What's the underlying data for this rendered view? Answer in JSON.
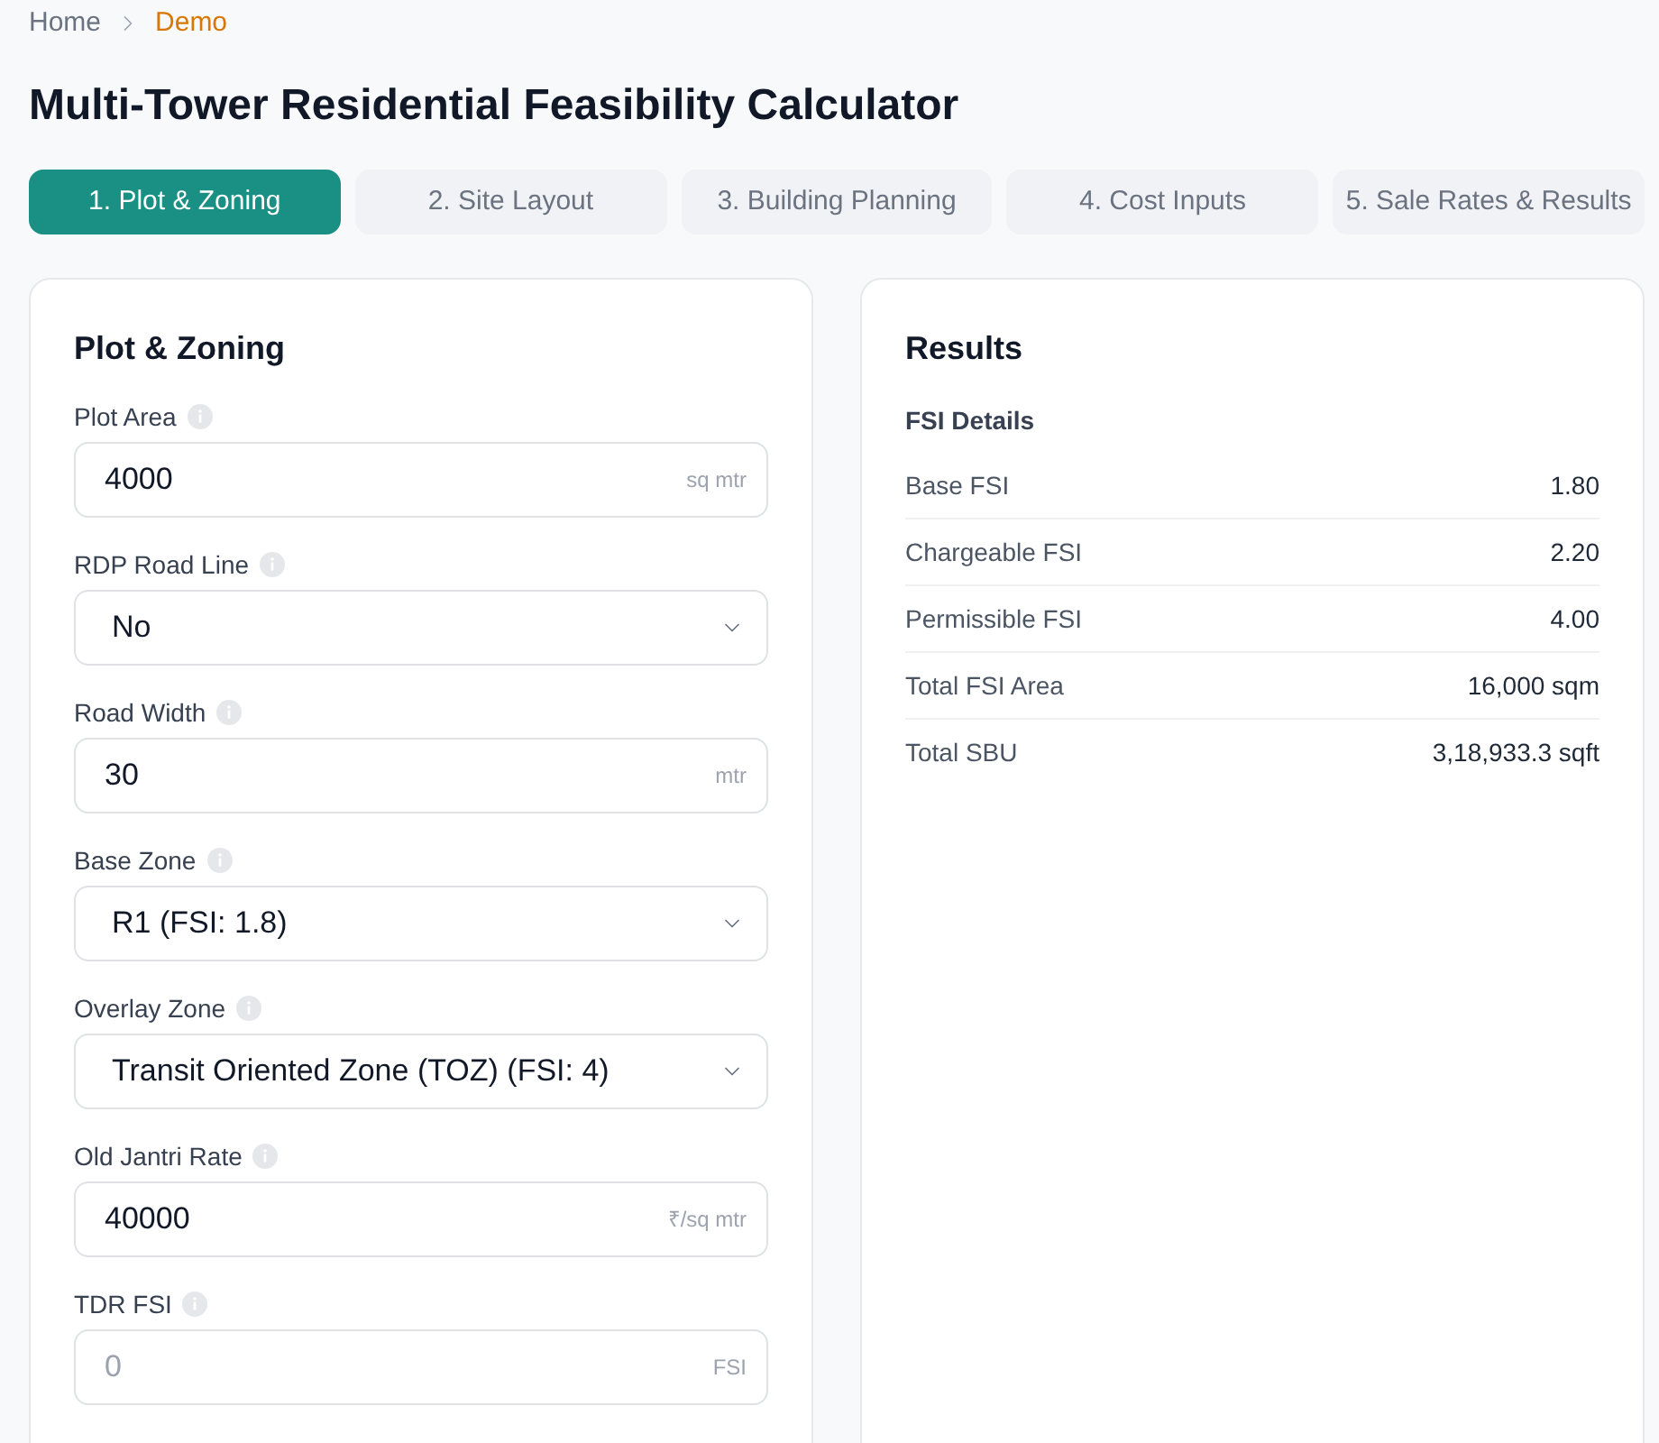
{
  "breadcrumb": [
    {
      "label": "Home",
      "current": false
    },
    {
      "label": "Demo",
      "current": true
    }
  ],
  "title": "Multi-Tower Residential Feasibility Calculator",
  "tabs": [
    {
      "label": "1. Plot & Zoning",
      "selected": true
    },
    {
      "label": "2. Site Layout",
      "selected": false
    },
    {
      "label": "3. Building Planning",
      "selected": false
    },
    {
      "label": "4. Cost Inputs",
      "selected": false
    },
    {
      "label": "5. Sale Rates & Results",
      "selected": false
    }
  ],
  "form": {
    "title": "Plot & Zoning",
    "fields": [
      {
        "kind": "input",
        "label": "Plot Area",
        "value": "4000",
        "unit": "sq mtr"
      },
      {
        "kind": "select",
        "label": "RDP Road Line",
        "value": "No"
      },
      {
        "kind": "input",
        "label": "Road Width",
        "value": "30",
        "unit": "mtr"
      },
      {
        "kind": "select",
        "label": "Base Zone",
        "value": "R1 (FSI: 1.8)"
      },
      {
        "kind": "select",
        "label": "Overlay Zone",
        "value": "Transit Oriented Zone (TOZ) (FSI: 4)"
      },
      {
        "kind": "input",
        "label": "Old Jantri Rate",
        "value": "40000",
        "unit": "₹/sq mtr"
      },
      {
        "kind": "input",
        "label": "TDR FSI",
        "placeholder": "0",
        "unit": "FSI"
      }
    ]
  },
  "results": {
    "title": "Results",
    "section": "FSI Details",
    "rows": [
      {
        "label": "Base FSI",
        "value": "1.80"
      },
      {
        "label": "Chargeable FSI",
        "value": "2.20"
      },
      {
        "label": "Permissible FSI",
        "value": "4.00"
      },
      {
        "label": "Total FSI Area",
        "value": "16,000 sqm"
      },
      {
        "label": "Total SBU",
        "value": "3,18,933.3 sqft"
      }
    ]
  }
}
